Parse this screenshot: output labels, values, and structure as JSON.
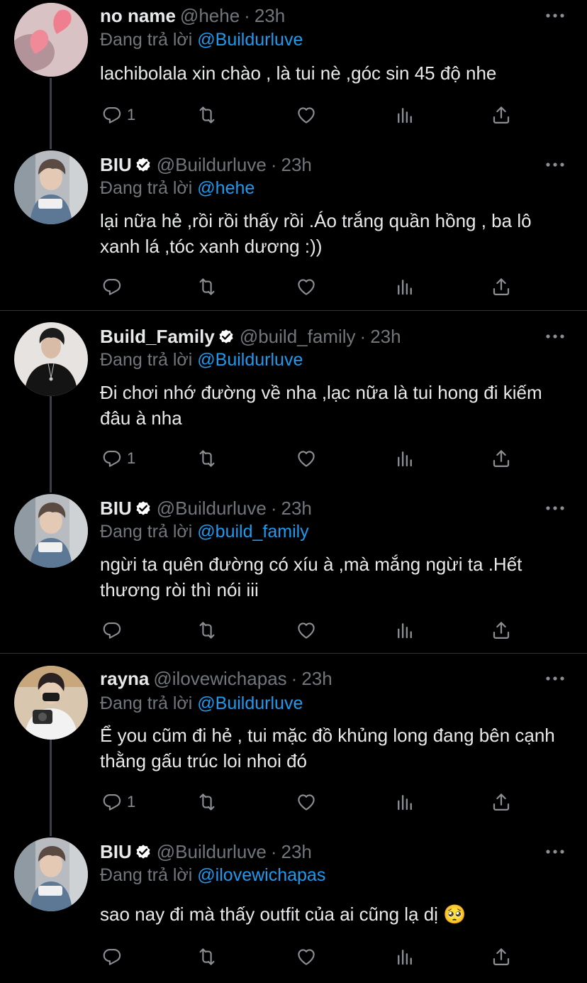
{
  "tweets": [
    {
      "name": "no name",
      "handle": "@hehe",
      "time": "23h",
      "verified": false,
      "replying_label": "Đang trả lời",
      "replying_to": "@Buildurluve",
      "text": "lachibolala xin chào , là tui nè ,góc sin 45 độ nhe",
      "reply_count": "1",
      "avatar": "pink-hearts-avatar"
    },
    {
      "name": "BIU",
      "handle": "@Buildurluve",
      "time": "23h",
      "verified": true,
      "replying_label": "Đang trả lời",
      "replying_to": "@hehe",
      "text": "lại nữa hẻ ,rồi rồi thấy rồi .Áo trắng quần hồng , ba lô xanh lá ,tóc xanh dương :))",
      "reply_count": "",
      "avatar": "biu-avatar"
    },
    {
      "name": "Build_Family",
      "handle": "@build_family",
      "time": "23h",
      "verified": true,
      "replying_label": "Đang trả lời",
      "replying_to": "@Buildurluve",
      "text": "Đi chơi nhớ đường về nha ,lạc nữa là tui hong đi kiếm đâu à nha",
      "reply_count": "1",
      "avatar": "build-family-avatar"
    },
    {
      "name": "BIU",
      "handle": "@Buildurluve",
      "time": "23h",
      "verified": true,
      "replying_label": "Đang trả lời",
      "replying_to": "@build_family",
      "text": "ngừi ta quên đường có xíu à ,mà mắng ngừi ta .Hết thương ròi thì nói iii",
      "reply_count": "",
      "avatar": "biu-avatar"
    },
    {
      "name": "rayna",
      "handle": "@ilovewichapas",
      "time": "23h",
      "verified": false,
      "replying_label": "Đang trả lời",
      "replying_to": "@Buildurluve",
      "text": "Ể you cũm đi hẻ , tui mặc đồ khủng long đang bên cạnh thằng gấu trúc loi nhoi đó",
      "reply_count": "1",
      "avatar": "rayna-avatar"
    },
    {
      "name": "BIU",
      "handle": "@Buildurluve",
      "time": "23h",
      "verified": true,
      "replying_label": "Đang trả lời",
      "replying_to": "@ilovewichapas",
      "text": "sao nay đi mà thấy outfit của ai cũng lạ dị 🥺",
      "reply_count": "",
      "avatar": "biu-avatar"
    }
  ],
  "colors": {
    "background": "#000000",
    "text": "#e7e9ea",
    "muted": "#71767b",
    "mention": "#1d9bf0",
    "verified": "#ffffff",
    "thread_line": "#3c4046",
    "separator": "#2f3336"
  },
  "icons": {
    "reply": "reply-icon",
    "retweet": "retweet-icon",
    "like": "heart-icon",
    "views": "views-icon",
    "share": "share-icon",
    "more": "more-icon",
    "verified": "verified-badge-icon"
  }
}
